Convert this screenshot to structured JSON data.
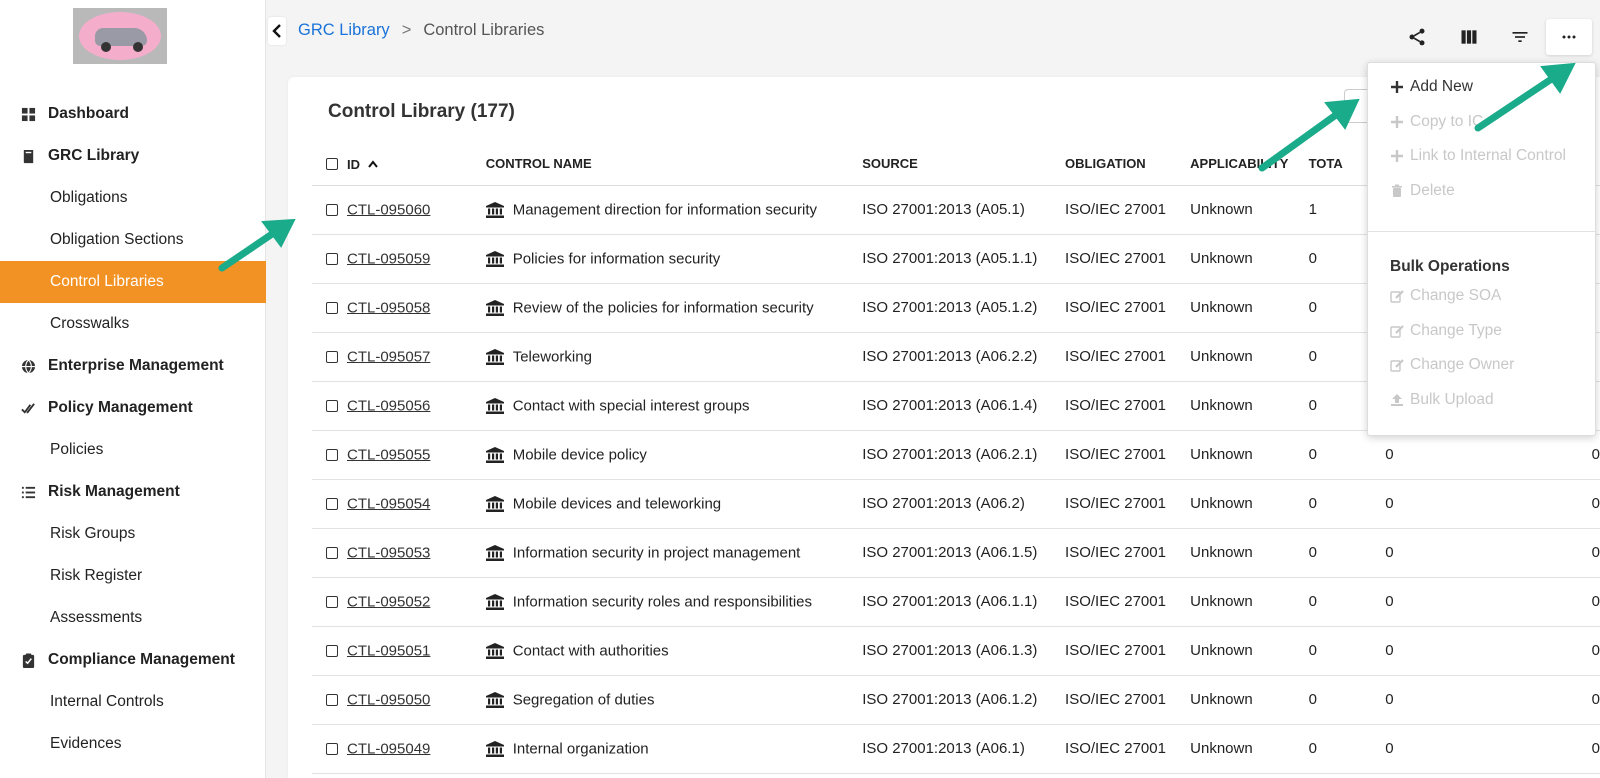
{
  "sidebar": {
    "items": [
      {
        "label": "Dashboard",
        "type": "section",
        "icon": "dashboard-icon"
      },
      {
        "label": "GRC Library",
        "type": "section",
        "icon": "book-icon"
      },
      {
        "label": "Obligations",
        "type": "sub"
      },
      {
        "label": "Obligation Sections",
        "type": "sub"
      },
      {
        "label": "Control Libraries",
        "type": "sub",
        "active": true
      },
      {
        "label": "Crosswalks",
        "type": "sub"
      },
      {
        "label": "Enterprise Management",
        "type": "section",
        "icon": "globe-icon"
      },
      {
        "label": "Policy Management",
        "type": "section",
        "icon": "check-double-icon"
      },
      {
        "label": "Policies",
        "type": "sub"
      },
      {
        "label": "Risk Management",
        "type": "section",
        "icon": "list-icon"
      },
      {
        "label": "Risk Groups",
        "type": "sub"
      },
      {
        "label": "Risk Register",
        "type": "sub"
      },
      {
        "label": "Assessments",
        "type": "sub"
      },
      {
        "label": "Compliance Management",
        "type": "section",
        "icon": "clipboard-check-icon"
      },
      {
        "label": "Internal Controls",
        "type": "sub"
      },
      {
        "label": "Evidences",
        "type": "sub"
      }
    ]
  },
  "breadcrumb": {
    "parent": "GRC Library",
    "separator": ">",
    "current": "Control Libraries"
  },
  "toolbar": {
    "share_icon": "share-icon",
    "columns_icon": "columns-icon",
    "filter_icon": "filter-icon",
    "more_icon": "more-horizontal-icon"
  },
  "library": {
    "title": "Control Library (177)"
  },
  "table": {
    "headers": [
      "ID",
      "CONTROL NAME",
      "SOURCE",
      "OBLIGATION",
      "APPLICABILITY",
      "TOTA"
    ],
    "rows": [
      {
        "id": "CTL-095060",
        "name": "Management direction for information security",
        "source": "ISO 27001:2013 (A05.1)",
        "obligation": "ISO/IEC 27001",
        "applicability": "Unknown",
        "total": "1",
        "c2": "",
        "c3": ""
      },
      {
        "id": "CTL-095059",
        "name": "Policies for information security",
        "source": "ISO 27001:2013 (A05.1.1)",
        "obligation": "ISO/IEC 27001",
        "applicability": "Unknown",
        "total": "0",
        "c2": "",
        "c3": ""
      },
      {
        "id": "CTL-095058",
        "name": "Review of the policies for information security",
        "source": "ISO 27001:2013 (A05.1.2)",
        "obligation": "ISO/IEC 27001",
        "applicability": "Unknown",
        "total": "0",
        "c2": "",
        "c3": ""
      },
      {
        "id": "CTL-095057",
        "name": "Teleworking",
        "source": "ISO 27001:2013 (A06.2.2)",
        "obligation": "ISO/IEC 27001",
        "applicability": "Unknown",
        "total": "0",
        "c2": "",
        "c3": ""
      },
      {
        "id": "CTL-095056",
        "name": "Contact with special interest groups",
        "source": "ISO 27001:2013 (A06.1.4)",
        "obligation": "ISO/IEC 27001",
        "applicability": "Unknown",
        "total": "0",
        "c2": "",
        "c3": ""
      },
      {
        "id": "CTL-095055",
        "name": "Mobile device policy",
        "source": "ISO 27001:2013 (A06.2.1)",
        "obligation": "ISO/IEC 27001",
        "applicability": "Unknown",
        "total": "0",
        "c2": "0",
        "c3": "0"
      },
      {
        "id": "CTL-095054",
        "name": "Mobile devices and teleworking",
        "source": "ISO 27001:2013 (A06.2)",
        "obligation": "ISO/IEC 27001",
        "applicability": "Unknown",
        "total": "0",
        "c2": "0",
        "c3": "0"
      },
      {
        "id": "CTL-095053",
        "name": "Information security in project management",
        "source": "ISO 27001:2013 (A06.1.5)",
        "obligation": "ISO/IEC 27001",
        "applicability": "Unknown",
        "total": "0",
        "c2": "0",
        "c3": "0"
      },
      {
        "id": "CTL-095052",
        "name": "Information security roles and responsibilities",
        "source": "ISO 27001:2013 (A06.1.1)",
        "obligation": "ISO/IEC 27001",
        "applicability": "Unknown",
        "total": "0",
        "c2": "0",
        "c3": "0"
      },
      {
        "id": "CTL-095051",
        "name": "Contact with authorities",
        "source": "ISO 27001:2013 (A06.1.3)",
        "obligation": "ISO/IEC 27001",
        "applicability": "Unknown",
        "total": "0",
        "c2": "0",
        "c3": "0"
      },
      {
        "id": "CTL-095050",
        "name": "Segregation of duties",
        "source": "ISO 27001:2013 (A06.1.2)",
        "obligation": "ISO/IEC 27001",
        "applicability": "Unknown",
        "total": "0",
        "c2": "0",
        "c3": "0"
      },
      {
        "id": "CTL-095049",
        "name": "Internal organization",
        "source": "ISO 27001:2013 (A06.1)",
        "obligation": "ISO/IEC 27001",
        "applicability": "Unknown",
        "total": "0",
        "c2": "0",
        "c3": "0"
      }
    ]
  },
  "dropdown": {
    "items": [
      {
        "label": "Add New",
        "icon": "plus-icon",
        "enabled": true
      },
      {
        "label": "Copy to IC",
        "icon": "plus-icon",
        "enabled": false
      },
      {
        "label": "Link to Internal Control",
        "icon": "plus-icon",
        "enabled": false
      },
      {
        "label": "Delete",
        "icon": "trash-icon",
        "enabled": false
      }
    ],
    "bulk_heading": "Bulk Operations",
    "bulk_items": [
      {
        "label": "Change SOA",
        "icon": "edit-icon"
      },
      {
        "label": "Change Type",
        "icon": "edit-icon"
      },
      {
        "label": "Change Owner",
        "icon": "edit-icon"
      },
      {
        "label": "Bulk Upload",
        "icon": "upload-icon"
      }
    ]
  },
  "colors": {
    "accent": "#f39224",
    "link": "#1a73d9",
    "annotation_arrow": "#1aab8a",
    "disabled": "#c8c8c8"
  }
}
